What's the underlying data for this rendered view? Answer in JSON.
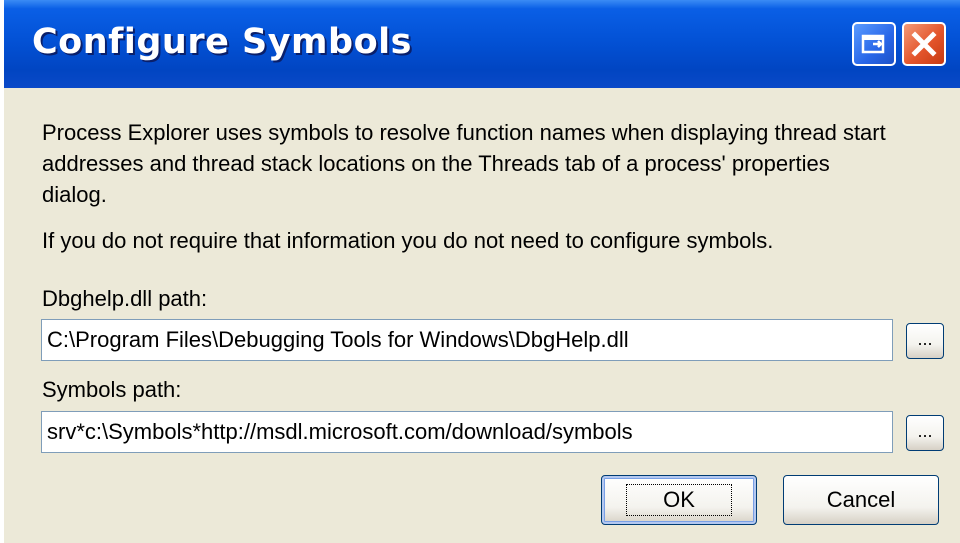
{
  "window": {
    "title": "Configure Symbols"
  },
  "titlebar": {
    "restore_icon": "restore-icon",
    "close_icon": "close-icon"
  },
  "content": {
    "intro_line1": "Process Explorer uses symbols to resolve function names when displaying thread start",
    "intro_line2": "addresses and thread stack locations on the Threads tab of a process' properties",
    "intro_line3": "dialog.",
    "note": "If you do not require that information you do not need to configure symbols."
  },
  "dbghelp": {
    "label": "Dbghelp.dll path:",
    "value": "C:\\Program Files\\Debugging Tools for Windows\\DbgHelp.dll",
    "browse_label": "..."
  },
  "symbols": {
    "label": "Symbols path:",
    "value": "srv*c:\\Symbols*http://msdl.microsoft.com/download/symbols",
    "browse_label": "..."
  },
  "buttons": {
    "ok_label": "OK",
    "cancel_label": "Cancel"
  },
  "colors": {
    "titlebar": "#0352d6",
    "dialog_bg": "#ece9d8",
    "close_button": "#e4552c"
  }
}
